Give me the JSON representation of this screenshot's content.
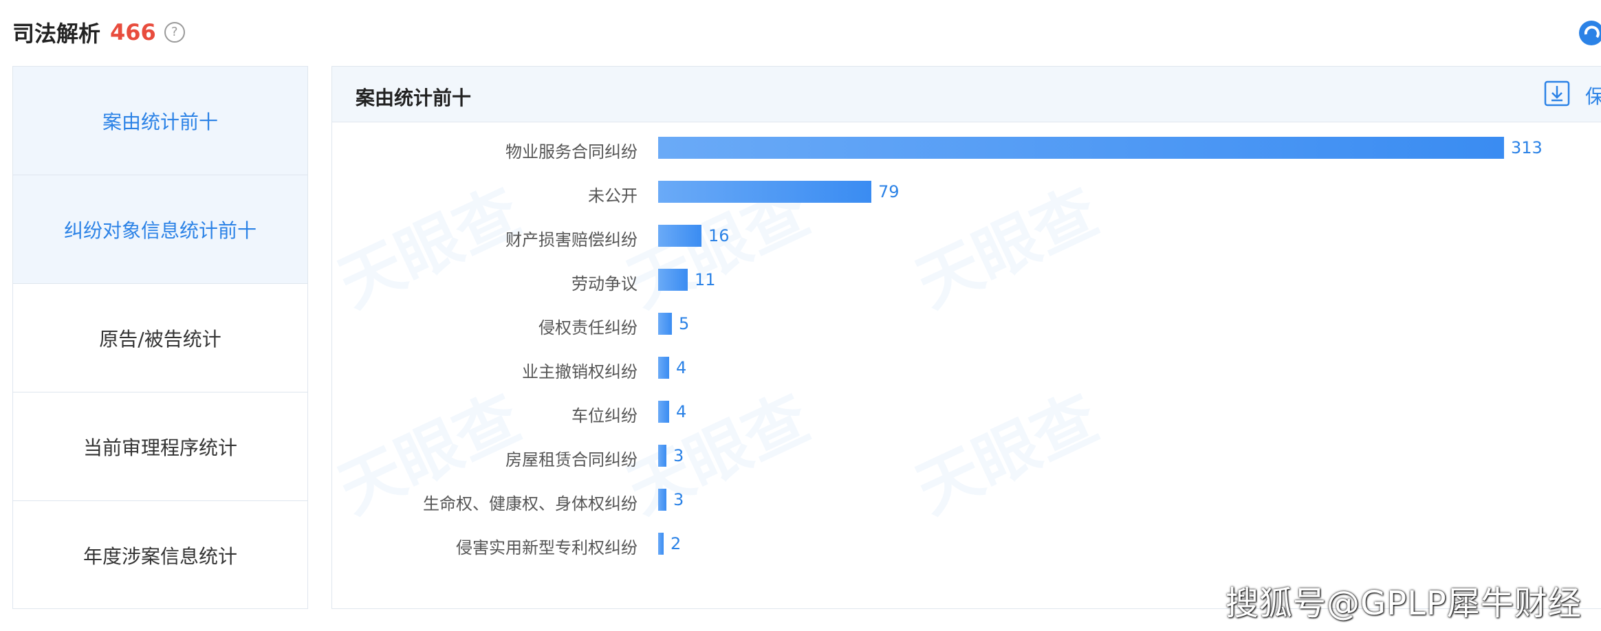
{
  "header": {
    "title": "司法解析",
    "count": "466",
    "help_icon": "question-circle-icon",
    "brand_icon": "tianyancha-logo-icon"
  },
  "sidebar": {
    "items": [
      {
        "label": "案由统计前十",
        "active": true
      },
      {
        "label": "纠纷对象信息统计前十",
        "active": false
      },
      {
        "label": "原告/被告统计",
        "active": false
      },
      {
        "label": "当前审理程序统计",
        "active": false
      },
      {
        "label": "年度涉案信息统计",
        "active": false
      }
    ]
  },
  "panel": {
    "title": "案由统计前十",
    "download_icon": "download-icon",
    "save_label": "保"
  },
  "watermark": {
    "text": "天眼查"
  },
  "chart_data": {
    "type": "bar",
    "orientation": "horizontal",
    "categories": [
      "物业服务合同纠纷",
      "未公开",
      "财产损害赔偿纠纷",
      "劳动争议",
      "侵权责任纠纷",
      "业主撤销权纠纷",
      "车位纠纷",
      "房屋租赁合同纠纷",
      "生命权、健康权、身体权纠纷",
      "侵害实用新型专利权纠纷"
    ],
    "values": [
      313,
      79,
      16,
      11,
      5,
      4,
      4,
      3,
      3,
      2
    ],
    "colors": {
      "bar_start": "#6aaaf7",
      "bar_end": "#3a8cf2",
      "value_label": "#2b82e6"
    }
  },
  "footer": {
    "text": "搜狐号@GPLP犀牛财经"
  },
  "colors": {
    "accent": "#2b82e6",
    "count_red": "#e84c3d",
    "active_bg": "#f0f6fd"
  }
}
